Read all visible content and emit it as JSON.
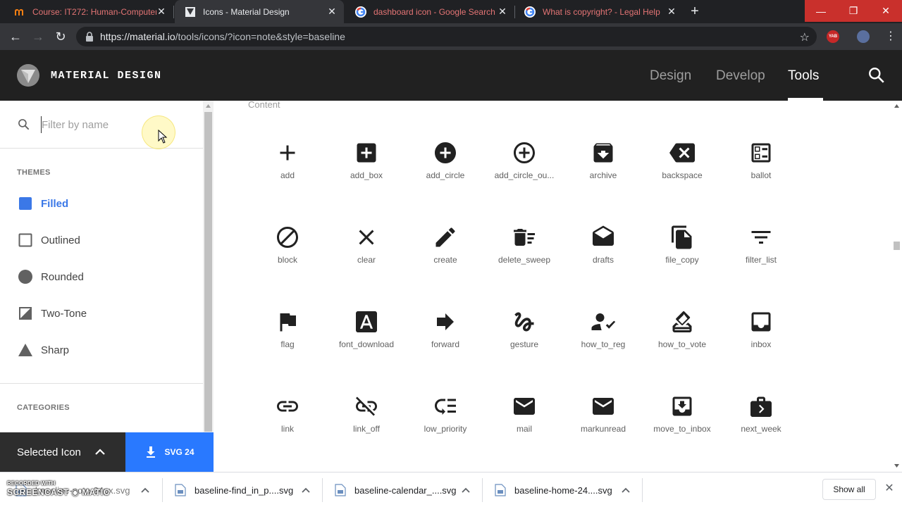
{
  "browser": {
    "tabs": [
      {
        "title": "Course: IT272: Human-Computer",
        "favicon": "moodle-icon",
        "active": false
      },
      {
        "title": "Icons - Material Design",
        "favicon": "material-icon",
        "active": true
      },
      {
        "title": "dashboard icon - Google Search",
        "favicon": "google-icon",
        "active": false
      },
      {
        "title": "What is copyright? - Legal Help",
        "favicon": "google-icon",
        "active": false
      }
    ],
    "url_host": "https://material.io",
    "url_path": "/tools/icons/?icon=note&style=baseline",
    "extension_badge": "YAB"
  },
  "header": {
    "brand": "MATERIAL DESIGN",
    "nav": [
      {
        "label": "Design",
        "active": false
      },
      {
        "label": "Develop",
        "active": false
      },
      {
        "label": "Tools",
        "active": true
      }
    ]
  },
  "sidebar": {
    "filter_placeholder": "Filter by name",
    "themes_heading": "THEMES",
    "themes": [
      {
        "label": "Filled",
        "icon": "filled-square-icon",
        "active": true
      },
      {
        "label": "Outlined",
        "icon": "outlined-square-icon",
        "active": false
      },
      {
        "label": "Rounded",
        "icon": "rounded-circle-icon",
        "active": false
      },
      {
        "label": "Two-Tone",
        "icon": "two-tone-icon",
        "active": false
      },
      {
        "label": "Sharp",
        "icon": "sharp-triangle-icon",
        "active": false
      }
    ],
    "categories_heading": "CATEGORIES"
  },
  "selected_bar": {
    "label": "Selected Icon",
    "download_label": "SVG 24"
  },
  "main": {
    "category": "Content",
    "icons": [
      "add",
      "add_box",
      "add_circle",
      "add_circle_ou...",
      "archive",
      "backspace",
      "ballot",
      "block",
      "clear",
      "create",
      "delete_sweep",
      "drafts",
      "file_copy",
      "filter_list",
      "flag",
      "font_download",
      "forward",
      "gesture",
      "how_to_reg",
      "how_to_vote",
      "inbox",
      "link",
      "link_off",
      "low_priority",
      "mail",
      "markunread",
      "move_to_inbox",
      "next_week"
    ]
  },
  "downloads": {
    "items": [
      "baseline-note-24px.svg",
      "baseline-find_in_p....svg",
      "baseline-calendar_....svg",
      "baseline-home-24....svg"
    ],
    "show_all": "Show all"
  },
  "watermark": {
    "line1": "RECORDED WITH",
    "line2": "SCREENCAST ◉ MATIC"
  },
  "colors": {
    "accent": "#2979ff",
    "active_theme": "#3b78e7",
    "header_bg": "#212121",
    "icon": "#212121"
  }
}
